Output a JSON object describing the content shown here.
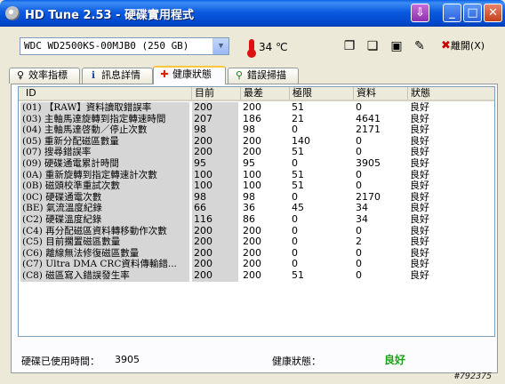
{
  "window": {
    "title": "HD Tune 2.53 - 硬碟實用程式"
  },
  "toolbar": {
    "drive_select": "WDC WD2500KS-00MJB0 (250 GB)",
    "temperature": "34 ℃",
    "exit_label": "離開(X)"
  },
  "tabs": [
    "效率指標",
    "訊息詳情",
    "健康狀態",
    "錯誤掃描"
  ],
  "grid": {
    "headers": {
      "id": "ID",
      "current": "目前",
      "worst": "最差",
      "threshold": "極限",
      "data": "資料",
      "status": "狀態"
    },
    "rows": [
      {
        "id": "(01) 【RAW】資料讀取錯誤率",
        "cur": "200",
        "wor": "200",
        "thr": "51",
        "dat": "0",
        "sta": "良好"
      },
      {
        "id": "(03) 主軸馬達旋轉到指定轉速時間",
        "cur": "207",
        "wor": "186",
        "thr": "21",
        "dat": "4641",
        "sta": "良好"
      },
      {
        "id": "(04) 主軸馬達啓動／停止次數",
        "cur": "98",
        "wor": "98",
        "thr": "0",
        "dat": "2171",
        "sta": "良好"
      },
      {
        "id": "(05) 重新分配磁區數量",
        "cur": "200",
        "wor": "200",
        "thr": "140",
        "dat": "0",
        "sta": "良好"
      },
      {
        "id": "(07) 搜尋錯誤率",
        "cur": "200",
        "wor": "200",
        "thr": "51",
        "dat": "0",
        "sta": "良好"
      },
      {
        "id": "(09) 硬碟通電累計時間",
        "cur": "95",
        "wor": "95",
        "thr": "0",
        "dat": "3905",
        "sta": "良好"
      },
      {
        "id": "(0A) 重新旋轉到指定轉速計次數",
        "cur": "100",
        "wor": "100",
        "thr": "51",
        "dat": "0",
        "sta": "良好"
      },
      {
        "id": "(0B) 磁頭校準重試次數",
        "cur": "100",
        "wor": "100",
        "thr": "51",
        "dat": "0",
        "sta": "良好"
      },
      {
        "id": "(0C) 硬碟通電次數",
        "cur": "98",
        "wor": "98",
        "thr": "0",
        "dat": "2170",
        "sta": "良好"
      },
      {
        "id": "(BE) 氣流溫度紀錄",
        "cur": "66",
        "wor": "36",
        "thr": "45",
        "dat": "34",
        "sta": "良好"
      },
      {
        "id": "(C2) 硬碟溫度紀錄",
        "cur": "116",
        "wor": "86",
        "thr": "0",
        "dat": "34",
        "sta": "良好"
      },
      {
        "id": "(C4) 再分配磁區資料轉移動作次數",
        "cur": "200",
        "wor": "200",
        "thr": "0",
        "dat": "0",
        "sta": "良好"
      },
      {
        "id": "(C5) 目前擱置磁區數量",
        "cur": "200",
        "wor": "200",
        "thr": "0",
        "dat": "2",
        "sta": "良好"
      },
      {
        "id": "(C6) 離線無法修復磁區數量",
        "cur": "200",
        "wor": "200",
        "thr": "0",
        "dat": "0",
        "sta": "良好"
      },
      {
        "id": "(C7) Ultra DMA CRC資料傳輸錯...",
        "cur": "200",
        "wor": "200",
        "thr": "0",
        "dat": "0",
        "sta": "良好"
      },
      {
        "id": "(C8) 磁區寫入錯誤發生率",
        "cur": "200",
        "wor": "200",
        "thr": "51",
        "dat": "0",
        "sta": "良好"
      }
    ]
  },
  "status_bar": {
    "hours_label": "硬碟已使用時間：",
    "hours_value": "3905",
    "health_label": "健康狀態：",
    "health_value": "良好"
  },
  "watermark": "#792375"
}
